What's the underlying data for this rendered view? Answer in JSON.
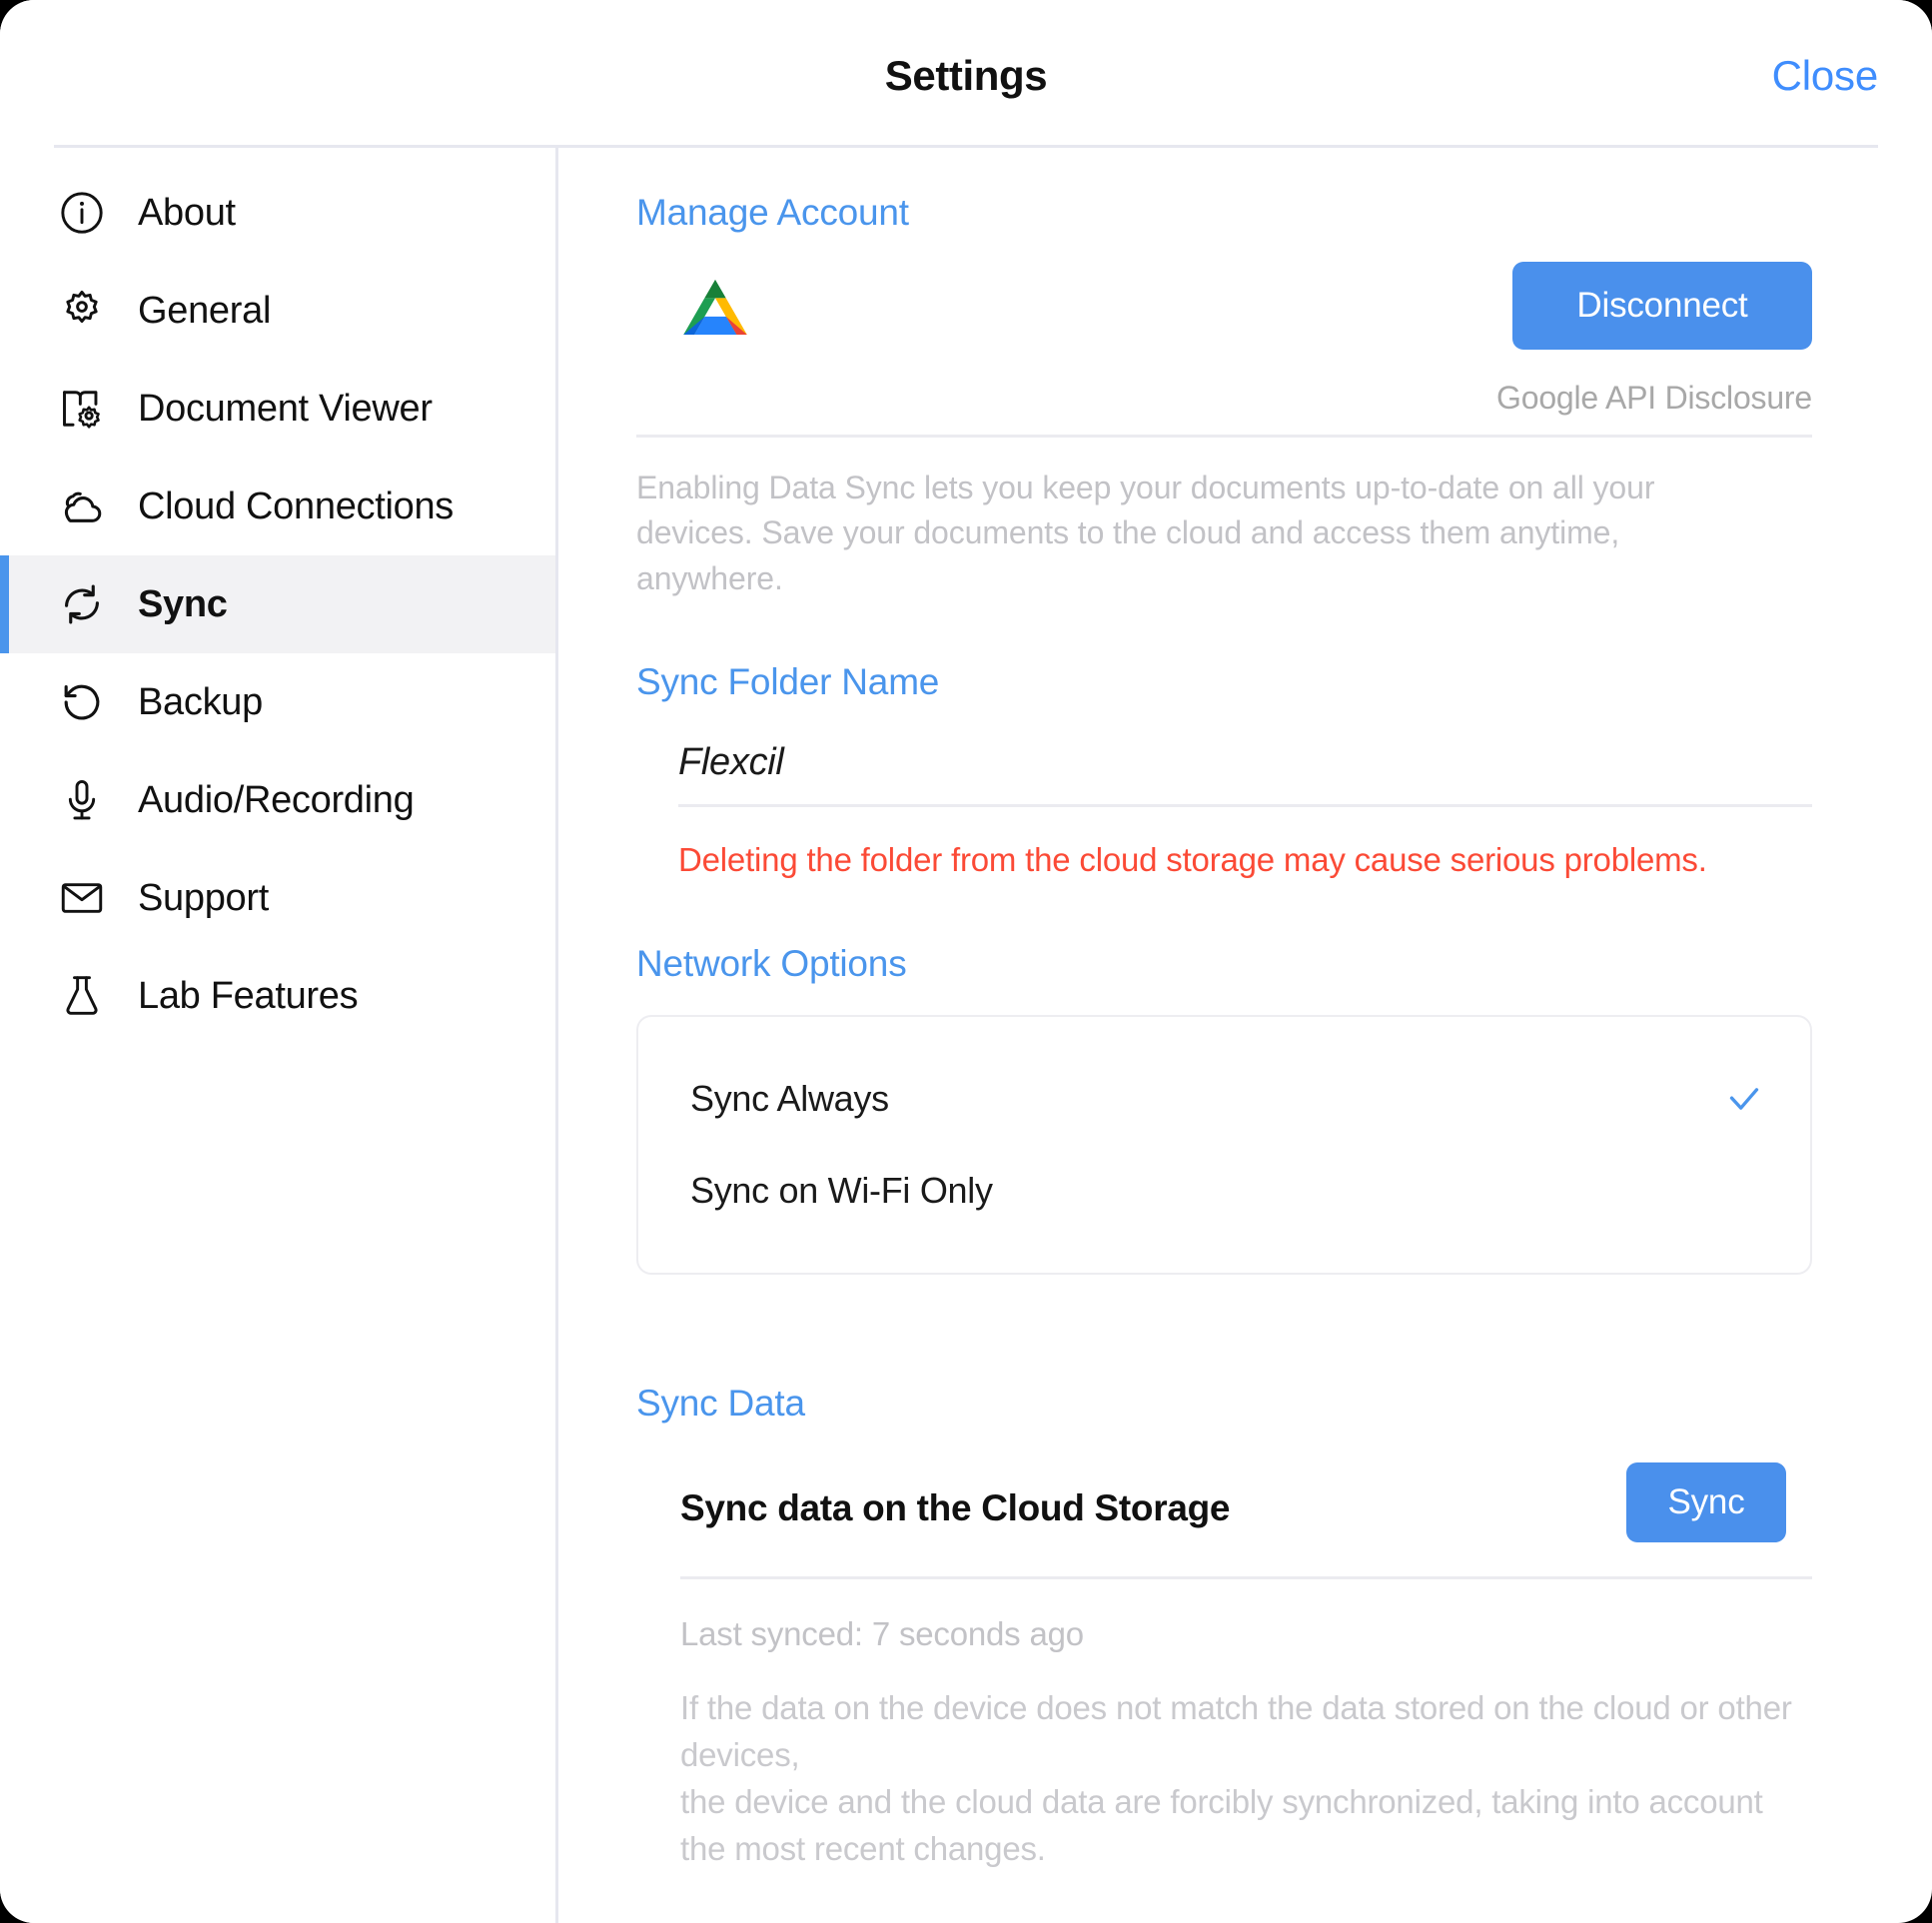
{
  "window": {
    "title": "Settings",
    "close_label": "Close"
  },
  "sidebar": {
    "items": [
      {
        "label": "About",
        "icon": "info-circle-icon",
        "selected": false
      },
      {
        "label": "General",
        "icon": "gear-icon",
        "selected": false
      },
      {
        "label": "Document Viewer",
        "icon": "book-gear-icon",
        "selected": false
      },
      {
        "label": "Cloud Connections",
        "icon": "cloud-icon",
        "selected": false
      },
      {
        "label": "Sync",
        "icon": "sync-refresh-icon",
        "selected": true
      },
      {
        "label": "Backup",
        "icon": "restore-arrow-icon",
        "selected": false
      },
      {
        "label": "Audio/Recording",
        "icon": "microphone-icon",
        "selected": false
      },
      {
        "label": "Support",
        "icon": "envelope-icon",
        "selected": false
      },
      {
        "label": "Lab Features",
        "icon": "flask-icon",
        "selected": false
      }
    ]
  },
  "content": {
    "manage_account": {
      "header": "Manage Account",
      "provider_icon": "google-drive-icon",
      "disconnect_label": "Disconnect",
      "api_disclosure_label": "Google API Disclosure",
      "description": "Enabling Data Sync lets you keep your documents up-to-date on all your devices. Save your documents to the cloud and access them anytime, anywhere."
    },
    "sync_folder": {
      "header": "Sync Folder Name",
      "value": "Flexcil",
      "placeholder": "Flexcil",
      "warning": "Deleting the folder from the cloud storage may cause serious problems."
    },
    "network_options": {
      "header": "Network Options",
      "options": [
        {
          "label": "Sync Always",
          "checked": true
        },
        {
          "label": "Sync on Wi-Fi Only",
          "checked": false
        }
      ]
    },
    "sync_data": {
      "header": "Sync Data",
      "row_label": "Sync data on the Cloud Storage",
      "button_label": "Sync",
      "last_synced": "Last synced: 7 seconds ago",
      "note": "If the data on the device does not match the data stored on the cloud or other devices,\nthe device and the cloud data are forcibly synchronized, taking into account the most recent changes."
    }
  },
  "colors": {
    "accent_blue": "#4a95ec",
    "button_blue": "#4a90ec",
    "warning_red": "#fb4a36",
    "muted_gray": "#c2c2c6",
    "selected_bg": "#f2f2f4"
  }
}
